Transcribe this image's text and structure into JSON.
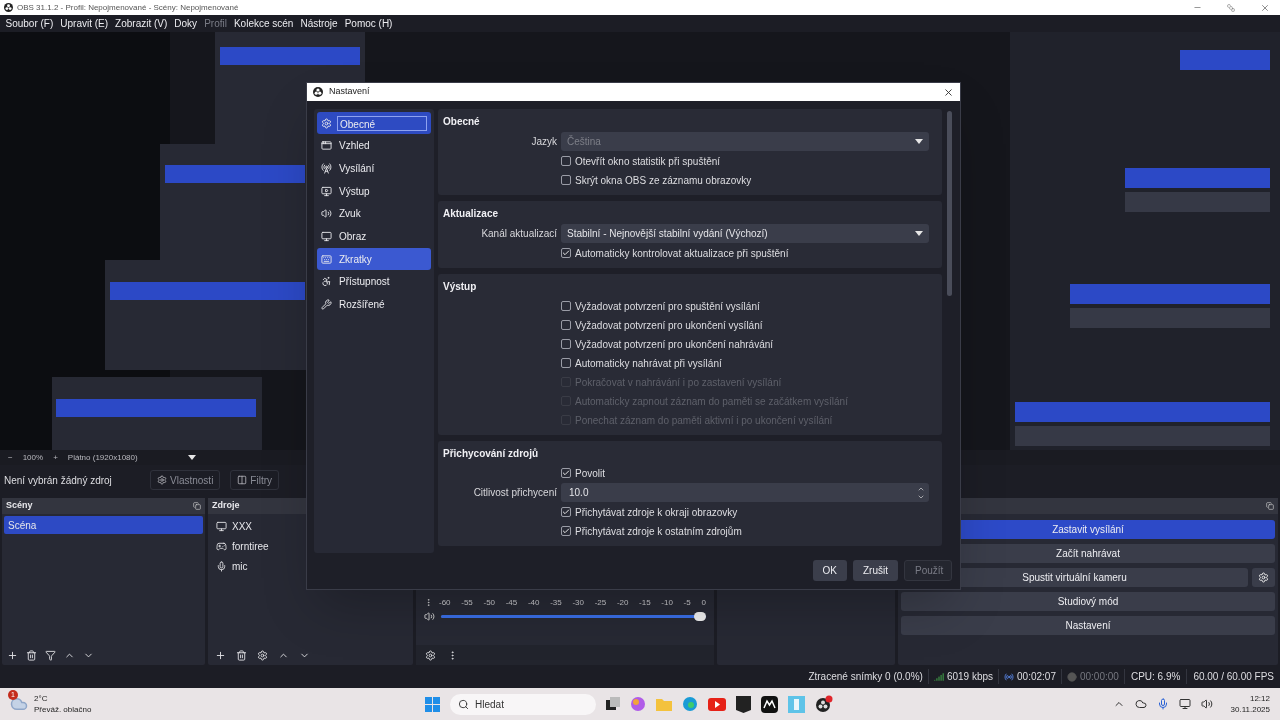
{
  "window": {
    "title": "OBS 31.1.2 - Profil: Nepojmenované - Scény: Nepojmenované"
  },
  "menu": [
    {
      "label": "Soubor (F)",
      "disabled": false
    },
    {
      "label": "Upravit (E)",
      "disabled": false
    },
    {
      "label": "Zobrazit (V)",
      "disabled": false
    },
    {
      "label": "Doky",
      "disabled": false
    },
    {
      "label": "Profil",
      "disabled": true
    },
    {
      "label": "Kolekce scén",
      "disabled": false
    },
    {
      "label": "Nástroje",
      "disabled": false
    },
    {
      "label": "Pomoc (H)",
      "disabled": false
    }
  ],
  "canvas_bar": {
    "minus": "−",
    "zoom": "100%",
    "plus": "+",
    "canvas": "Plátno (1920x1080)"
  },
  "source_bar": {
    "text": "Není vybrán žádný zdroj",
    "buttons": [
      "Vlastnosti",
      "Filtry"
    ]
  },
  "scenes": {
    "title": "Scény",
    "items": [
      {
        "label": "Scéna",
        "selected": true
      }
    ]
  },
  "sources": {
    "title": "Zdroje",
    "items": [
      {
        "label": "XXX",
        "kind": "display"
      },
      {
        "label": "forntiree",
        "kind": "game"
      },
      {
        "label": "mic",
        "kind": "audio"
      }
    ]
  },
  "mixer": {
    "ticks": [
      "-60",
      "-55",
      "-50",
      "-45",
      "-40",
      "-35",
      "-30",
      "-25",
      "-20",
      "-15",
      "-10",
      "-5",
      "0"
    ],
    "level": 1
  },
  "controls": {
    "buttons": [
      {
        "label": "Zastavit vysílání",
        "active": true,
        "settings": false
      },
      {
        "label": "Začít nahrávat",
        "active": false,
        "settings": false
      },
      {
        "label": "Spustit virtuální kameru",
        "active": false,
        "settings": true
      },
      {
        "label": "Studiový mód",
        "active": false,
        "settings": false
      },
      {
        "label": "Nastavení",
        "active": false,
        "settings": false
      }
    ]
  },
  "status_bar": {
    "dropped": "Ztracené snímky 0 (0.0%)",
    "bitrate": "6019 kbps",
    "stream_time": "00:02:07",
    "record_time": "00:00:00",
    "cpu": "CPU: 6.9%",
    "fps": "60.00 / 60.00 FPS"
  },
  "dialog": {
    "title": "Nastavení",
    "categories": [
      {
        "label": "Obecné",
        "selected": true,
        "hovered": false
      },
      {
        "label": "Vzhled",
        "selected": false,
        "hovered": false
      },
      {
        "label": "Vysílání",
        "selected": false,
        "hovered": false
      },
      {
        "label": "Výstup",
        "selected": false,
        "hovered": false
      },
      {
        "label": "Zvuk",
        "selected": false,
        "hovered": false
      },
      {
        "label": "Obraz",
        "selected": false,
        "hovered": false
      },
      {
        "label": "Zkratky",
        "selected": false,
        "hovered": true
      },
      {
        "label": "Přístupnost",
        "selected": false,
        "hovered": false
      },
      {
        "label": "Rozšířené",
        "selected": false,
        "hovered": false
      }
    ],
    "sections": [
      {
        "title": "Obecné",
        "rows": [
          {
            "kind": "select",
            "label": "Jazyk",
            "value": "Čeština",
            "disabled": true
          },
          {
            "kind": "checkbox",
            "label": "Otevřít okno statistik při spuštění",
            "checked": false,
            "disabled": false
          },
          {
            "kind": "checkbox",
            "label": "Skrýt okna OBS ze záznamu obrazovky",
            "checked": false,
            "disabled": false
          }
        ]
      },
      {
        "title": "Aktualizace",
        "rows": [
          {
            "kind": "select",
            "label": "Kanál aktualizací",
            "value": "Stabilní - Nejnovější stabilní vydání (Výchozí)",
            "disabled": false
          },
          {
            "kind": "checkbox",
            "label": "Automaticky kontrolovat aktualizace při spuštění",
            "checked": true,
            "disabled": false
          }
        ]
      },
      {
        "title": "Výstup",
        "rows": [
          {
            "kind": "checkbox",
            "label": "Vyžadovat potvrzení pro spuštění vysílání",
            "checked": false,
            "disabled": false
          },
          {
            "kind": "checkbox",
            "label": "Vyžadovat potvrzení pro ukončení vysílání",
            "checked": false,
            "disabled": false
          },
          {
            "kind": "checkbox",
            "label": "Vyžadovat potvrzení pro ukončení nahrávání",
            "checked": false,
            "disabled": false
          },
          {
            "kind": "checkbox",
            "label": "Automaticky nahrávat při vysílání",
            "checked": false,
            "disabled": false
          },
          {
            "kind": "checkbox",
            "label": "Pokračovat v nahrávání i po zastavení vysílání",
            "checked": false,
            "disabled": true
          },
          {
            "kind": "checkbox",
            "label": "Automaticky zapnout záznam do paměti se začátkem vysílání",
            "checked": false,
            "disabled": true
          },
          {
            "kind": "checkbox",
            "label": "Ponechat záznam do paměti aktivní i po ukončení vysílání",
            "checked": false,
            "disabled": true
          }
        ]
      },
      {
        "title": "Přichycování zdrojů",
        "rows": [
          {
            "kind": "checkbox",
            "label": "Povolit",
            "checked": true,
            "disabled": false
          },
          {
            "kind": "spin",
            "label": "Citlivost přichycení",
            "value": "10.0"
          },
          {
            "kind": "checkbox",
            "label": "Přichytávat zdroje k okraji obrazovky",
            "checked": true,
            "disabled": false
          },
          {
            "kind": "checkbox",
            "label": "Přichytávat zdroje k ostatním zdrojům",
            "checked": true,
            "disabled": false
          }
        ]
      }
    ],
    "buttons": [
      {
        "label": "OK",
        "disabled": false
      },
      {
        "label": "Zrušit",
        "disabled": false
      },
      {
        "label": "Použít",
        "disabled": true
      }
    ]
  },
  "taskbar": {
    "weather": {
      "badge": "1",
      "temp": "2°C",
      "text": "Převáž. oblačno"
    },
    "search": {
      "placeholder": "Hledat"
    },
    "time": "12:12",
    "date": "30.11.2025"
  }
}
